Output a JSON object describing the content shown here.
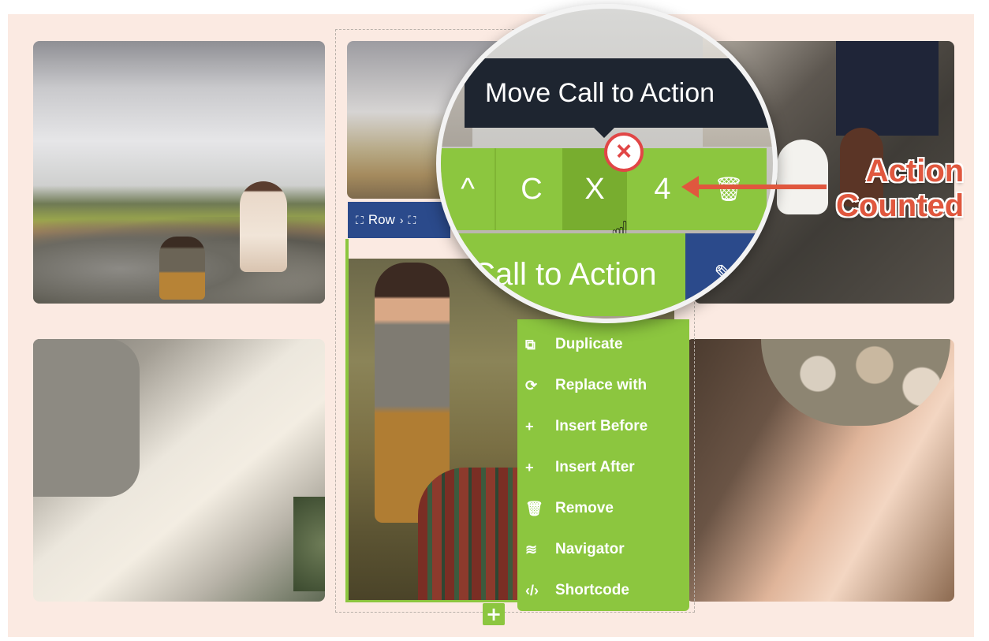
{
  "row_label": "Row",
  "menu": {
    "items": [
      {
        "label": "Duplicate",
        "icon": "duplicate-icon"
      },
      {
        "label": "Replace with",
        "icon": "replace-icon"
      },
      {
        "label": "Insert Before",
        "icon": "plus-icon"
      },
      {
        "label": "Insert After",
        "icon": "plus-icon"
      },
      {
        "label": "Remove",
        "icon": "trash-icon"
      },
      {
        "label": "Navigator",
        "icon": "layers-icon"
      },
      {
        "label": "Shortcode",
        "icon": "code-icon"
      }
    ]
  },
  "lens": {
    "tooltip": "Move Call to Action",
    "toolbar": {
      "up": "^",
      "c": "C",
      "x": "X",
      "count": "4"
    },
    "element_label": "Call to Action"
  },
  "annotation": {
    "line1": "Action",
    "line2": "Counted",
    "color": "#e0573e"
  },
  "colors": {
    "accent_green": "#8cc63f",
    "navy": "#2b4a8b",
    "canvas": "#fbeae2"
  }
}
